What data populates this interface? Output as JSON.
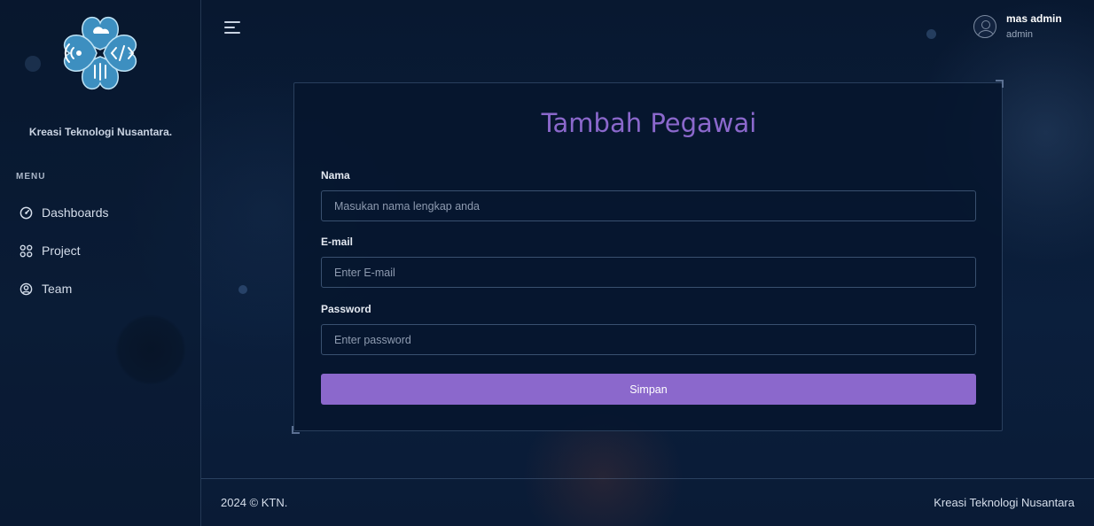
{
  "sidebar": {
    "brand": "Kreasi Teknologi Nusantara.",
    "menu_title": "MENU",
    "items": [
      {
        "label": "Dashboards",
        "icon": "gauge-icon"
      },
      {
        "label": "Project",
        "icon": "grid-icon"
      },
      {
        "label": "Team",
        "icon": "user-circle-icon"
      }
    ]
  },
  "header": {
    "menu_icon": "hamburger-icon",
    "user_name": "mas admin",
    "user_role": "admin"
  },
  "form": {
    "title": "Tambah Pegawai",
    "name_label": "Nama",
    "name_placeholder": "Masukan nama lengkap anda",
    "email_label": "E-mail",
    "email_placeholder": "Enter E-mail",
    "password_label": "Password",
    "password_placeholder": "Enter password",
    "submit_label": "Simpan"
  },
  "footer": {
    "copyright": "2024 © KTN.",
    "company": "Kreasi Teknologi Nusantara"
  },
  "colors": {
    "accent": "#8b68cc",
    "background": "#0a1a33",
    "logo": "#3d8fc0"
  }
}
